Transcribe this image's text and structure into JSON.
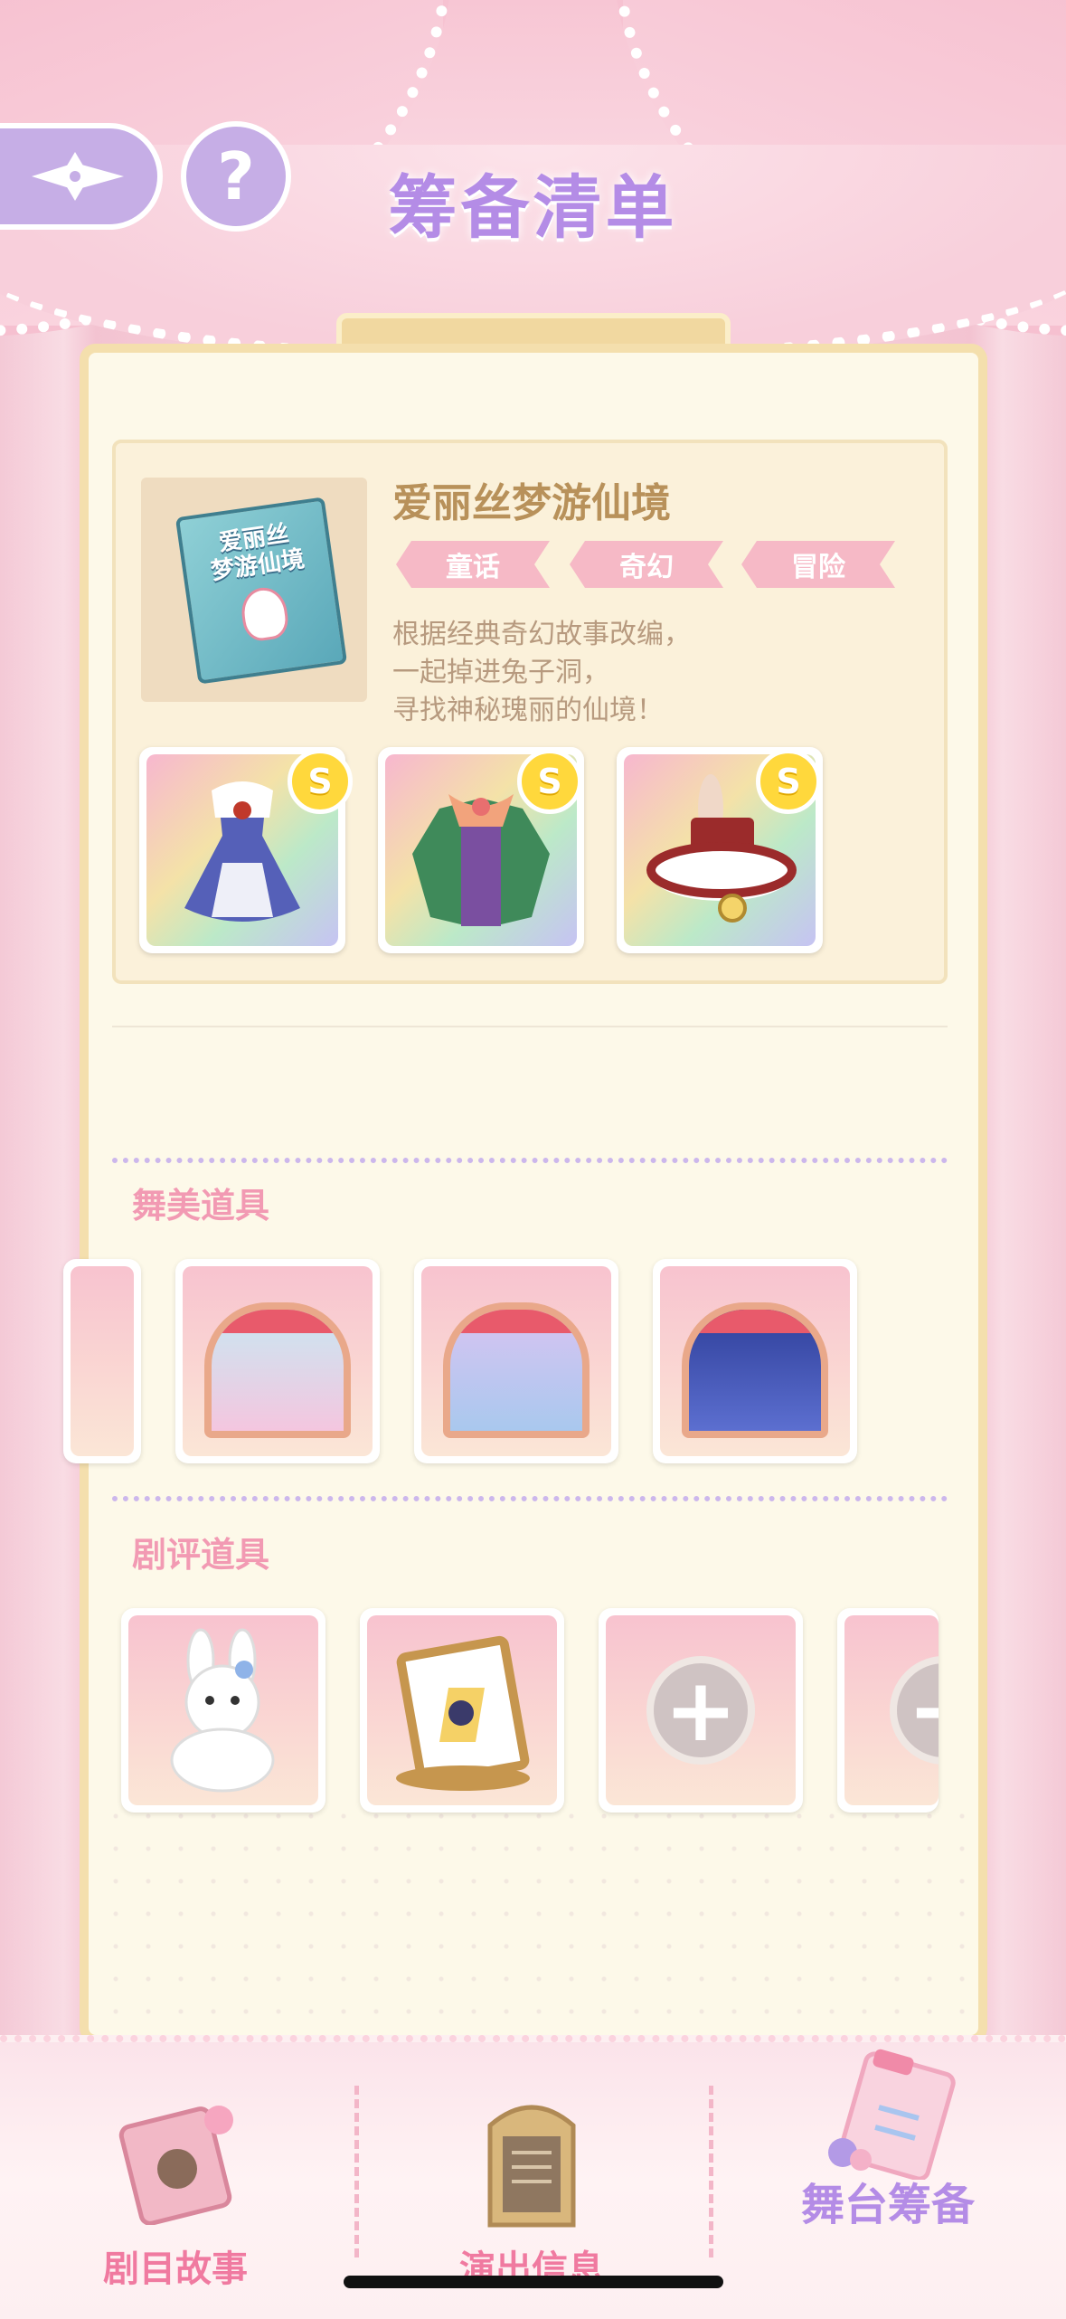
{
  "header": {
    "title": "筹备清单",
    "help_label": "?"
  },
  "story": {
    "cover_text": [
      "爱丽丝",
      "梦游仙境"
    ],
    "title": "爱丽丝梦游仙境",
    "tags": [
      "童话",
      "奇幻",
      "冒险"
    ],
    "description": [
      "根据经典奇幻故事改编，",
      "一起掉进兔子洞，",
      "寻找神秘瑰丽的仙境！"
    ],
    "outfits": [
      {
        "name": "maid-dress",
        "rank": "S"
      },
      {
        "name": "green-suit",
        "rank": "S"
      },
      {
        "name": "bunny-hat",
        "rank": "S"
      }
    ]
  },
  "sections": {
    "stage_props_title": "舞美道具",
    "review_props_title": "剧评道具"
  },
  "stage_props": [
    {
      "name": "stage-heart"
    },
    {
      "name": "stage-wonderland"
    },
    {
      "name": "stage-night"
    }
  ],
  "review_props": [
    {
      "name": "bunny-plush"
    },
    {
      "name": "card-frame"
    },
    {
      "name": "empty-slot",
      "plus": "+"
    },
    {
      "name": "empty-slot",
      "plus": "+"
    }
  ],
  "nav": {
    "story": "剧目故事",
    "info": "演出信息",
    "prep": "舞台筹备"
  },
  "colors": {
    "accent_purple": "#b48ce6",
    "pink": "#f07aa0",
    "gold": "#ffd83c"
  }
}
